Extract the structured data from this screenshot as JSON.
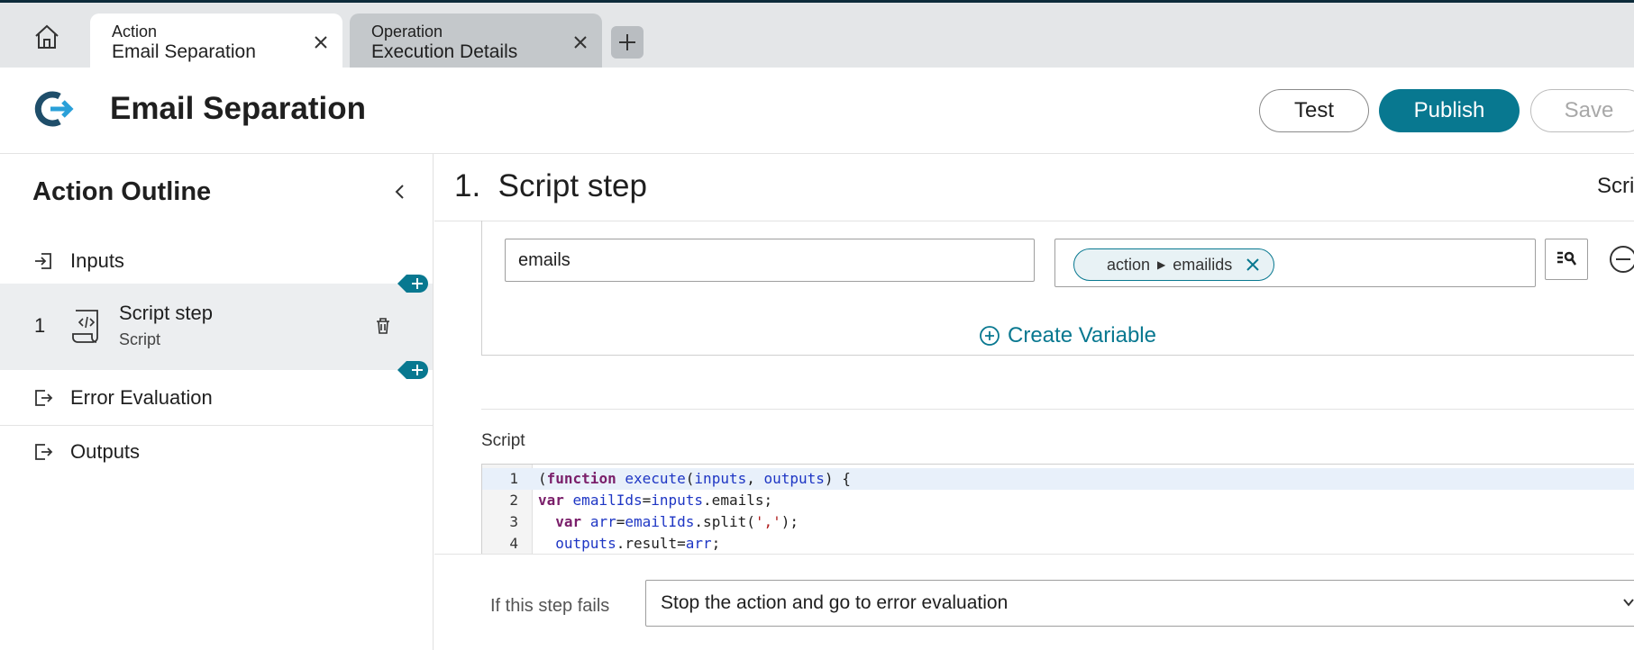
{
  "tabs": [
    {
      "type": "Action",
      "title": "Email Separation",
      "active": true
    },
    {
      "type": "Operation",
      "title": "Execution Details",
      "active": false
    }
  ],
  "header": {
    "title": "Email Separation",
    "buttons": {
      "test": "Test",
      "publish": "Publish",
      "save": "Save"
    }
  },
  "sidebar": {
    "title": "Action Outline",
    "inputs_label": "Inputs",
    "step": {
      "number": "1",
      "name": "Script step",
      "type": "Script"
    },
    "error_label": "Error Evaluation",
    "outputs_label": "Outputs"
  },
  "main": {
    "step_heading": "1.  Script step",
    "step_heading_right": "Scrip",
    "variable": {
      "name_value": "emails",
      "pill_parts": [
        "action",
        "emailids"
      ]
    },
    "create_variable": "Create Variable",
    "script_label": "Script",
    "code_lines": [
      {
        "n": "1"
      },
      {
        "n": "2"
      },
      {
        "n": "3"
      },
      {
        "n": "4"
      }
    ],
    "fail_label": "If this step fails",
    "fail_value": "Stop the action and go to error evaluation"
  },
  "colors": {
    "accent": "#087890",
    "header_bar": "#0d2b3a"
  }
}
